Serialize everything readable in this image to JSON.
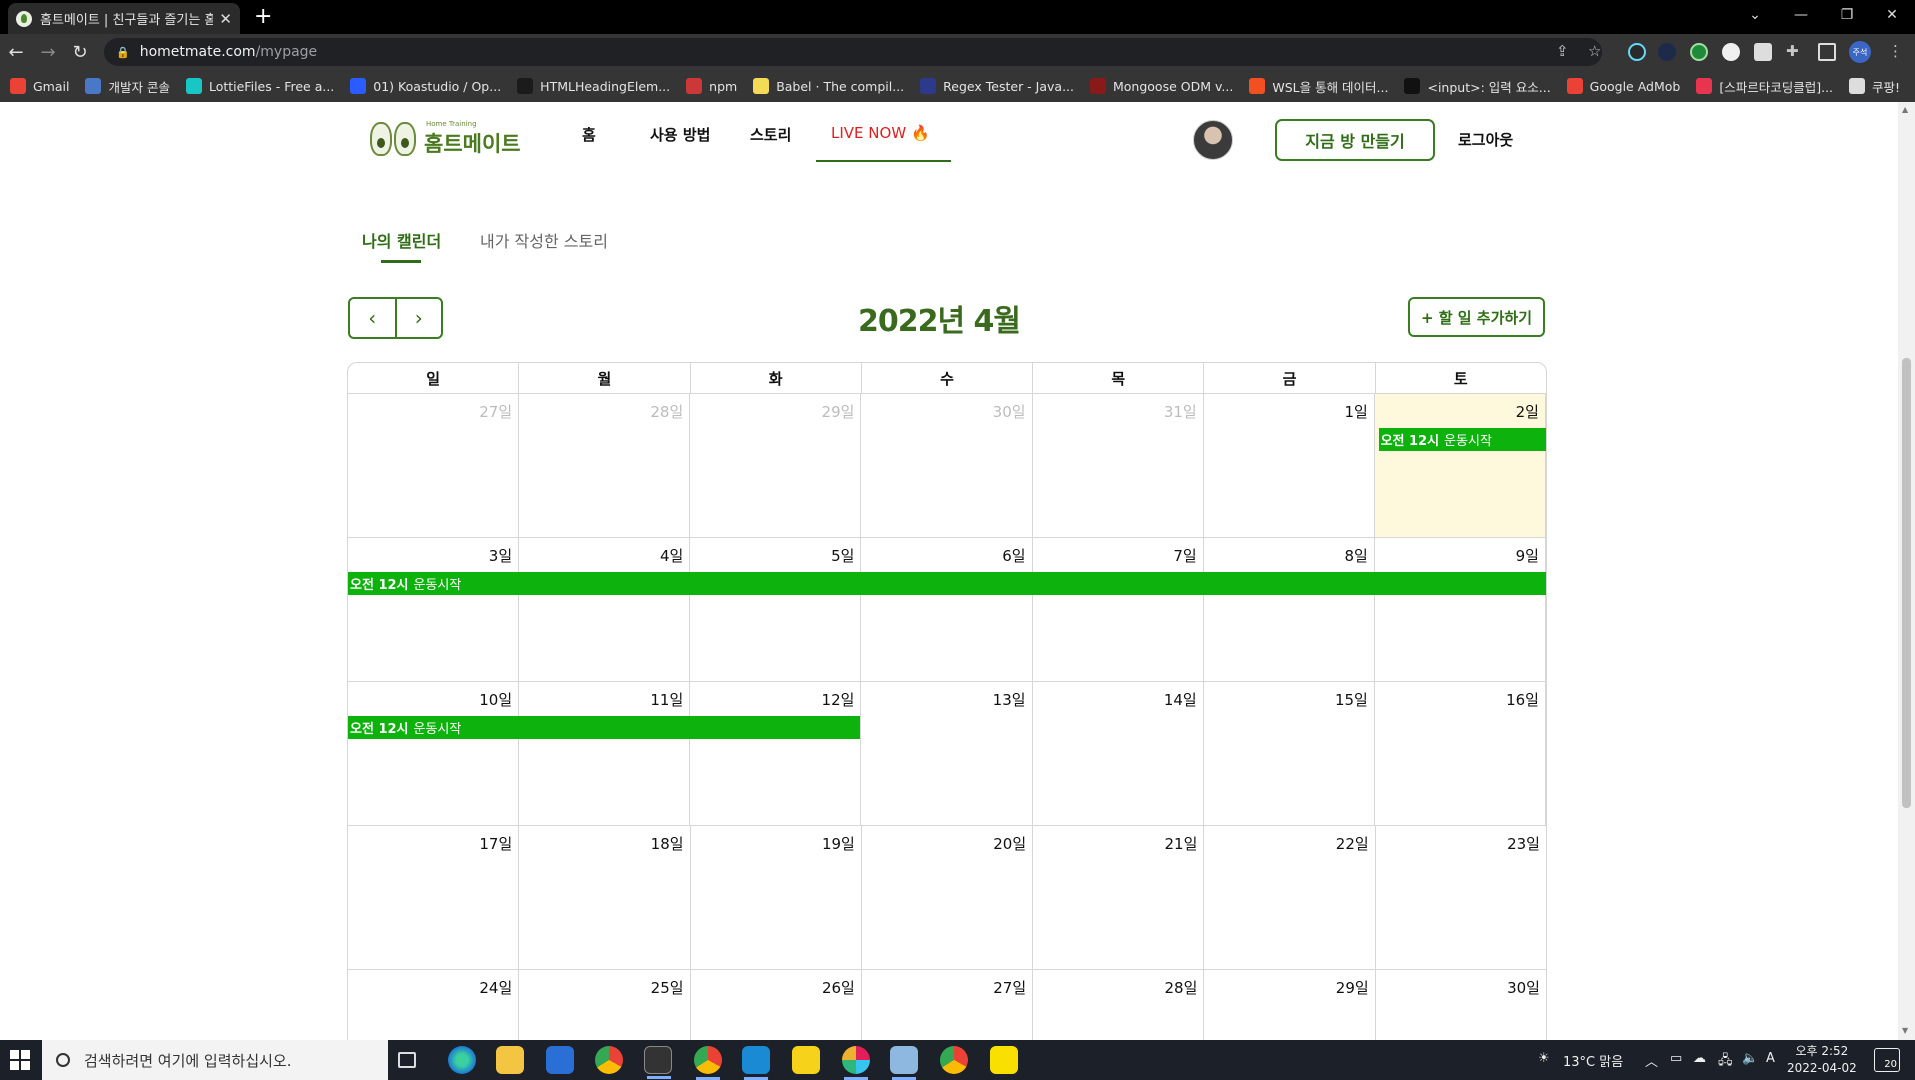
{
  "browser": {
    "tab_title": "홈트메이트 | 친구들과 즐기는 홈",
    "url_host": "hometmate.com",
    "url_path": "/mypage",
    "profile_label": "주석",
    "bookmarks": [
      {
        "label": "Gmail",
        "icon": "gmail-icon",
        "color": "#ea4335"
      },
      {
        "label": "개발자 콘솔",
        "icon": "console-icon",
        "color": "#4a78c8"
      },
      {
        "label": "LottieFiles - Free a...",
        "icon": "lottiefiles-icon",
        "color": "#19c6c6"
      },
      {
        "label": "01) Koastudio / Op...",
        "icon": "koastudio-icon",
        "color": "#2b5cff"
      },
      {
        "label": "HTMLHeadingElem...",
        "icon": "mdn-icon",
        "color": "#1b1b1b"
      },
      {
        "label": "npm",
        "icon": "npm-icon",
        "color": "#cb3837"
      },
      {
        "label": "Babel · The compil...",
        "icon": "babel-icon",
        "color": "#f5da55"
      },
      {
        "label": "Regex Tester - Java...",
        "icon": "regex-icon",
        "color": "#2d3a8c"
      },
      {
        "label": "Mongoose ODM v...",
        "icon": "mongoose-icon",
        "color": "#8a1a1a"
      },
      {
        "label": "WSL을 통해 데이터...",
        "icon": "microsoft-icon",
        "color": "#f25022"
      },
      {
        "label": "<input>: 입력 요소...",
        "icon": "mdn-input-icon",
        "color": "#111111"
      },
      {
        "label": "Google AdMob",
        "icon": "admob-icon",
        "color": "#ea4335"
      },
      {
        "label": "[스파르타코딩클럽]...",
        "icon": "sparta-icon",
        "color": "#e8344e"
      },
      {
        "label": "쿠팡!",
        "icon": "coupang-icon",
        "color": "#dddddd"
      }
    ]
  },
  "site": {
    "logo_sub": "Home Training",
    "logo_name": "홈트메이트",
    "nav": {
      "home": "홈",
      "how_to": "사용 방법",
      "story": "스토리",
      "live_now": "LIVE NOW",
      "live_emoji": "🔥"
    },
    "make_room_label": "지금 방 만들기",
    "logout_label": "로그아웃",
    "accent_color": "#2f6e17",
    "event_color": "#0db20d",
    "today_bg": "#fef8dc"
  },
  "mypage": {
    "tabs": [
      {
        "label": "나의 캘린더",
        "active": true
      },
      {
        "label": "내가 작성한 스토리",
        "active": false
      }
    ],
    "prev_label": "‹",
    "next_label": "›",
    "month_title": "2022년 4월",
    "add_todo_label": "+ 할 일 추가하기",
    "weekdays": [
      "일",
      "월",
      "화",
      "수",
      "목",
      "금",
      "토"
    ],
    "weeks": [
      [
        "27일",
        "28일",
        "29일",
        "30일",
        "31일",
        "1일",
        "2일"
      ],
      [
        "3일",
        "4일",
        "5일",
        "6일",
        "7일",
        "8일",
        "9일"
      ],
      [
        "10일",
        "11일",
        "12일",
        "13일",
        "14일",
        "15일",
        "16일"
      ],
      [
        "17일",
        "18일",
        "19일",
        "20일",
        "21일",
        "22일",
        "23일"
      ],
      [
        "24일",
        "25일",
        "26일",
        "27일",
        "28일",
        "29일",
        "30일"
      ]
    ],
    "events": [
      {
        "time": "오전 12시",
        "title": "운동시작"
      },
      {
        "time": "오전 12시",
        "title": "운동시작"
      },
      {
        "time": "오전 12시",
        "title": "운동시작"
      }
    ]
  },
  "taskbar": {
    "search_placeholder": "검색하려면 여기에 입력하십시오.",
    "weather": "13°C  맑음",
    "ime": "A",
    "time": "오후 2:52",
    "date": "2022-04-02",
    "notifications": "20"
  }
}
